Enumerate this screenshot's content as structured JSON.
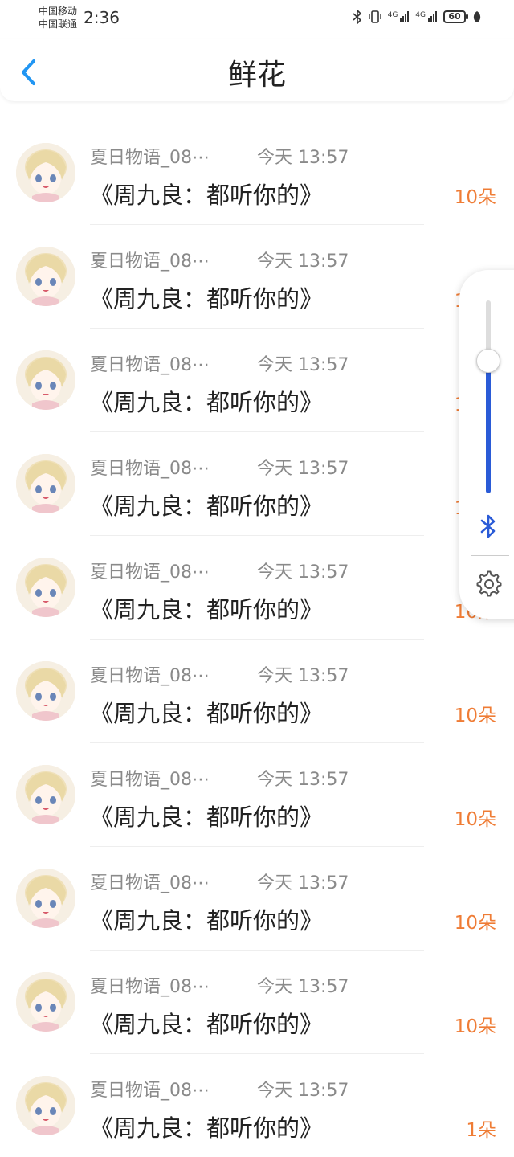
{
  "status_bar": {
    "carrier_1": "中国移动",
    "carrier_2": "中国联通",
    "time": "2:36",
    "net_1": "4G",
    "net_2": "4G",
    "battery": "60"
  },
  "header": {
    "title": "鲜花",
    "back_icon": "chevron-left-icon"
  },
  "items": [
    {
      "name": "夏日物语_08⋯",
      "time": "今天 13:57",
      "desc": "《周九良：都听你的》",
      "count": "10朵"
    },
    {
      "name": "夏日物语_08⋯",
      "time": "今天 13:57",
      "desc": "《周九良：都听你的》",
      "count": "10朵"
    },
    {
      "name": "夏日物语_08⋯",
      "time": "今天 13:57",
      "desc": "《周九良：都听你的》",
      "count": "10朵"
    },
    {
      "name": "夏日物语_08⋯",
      "time": "今天 13:57",
      "desc": "《周九良：都听你的》",
      "count": "10朵"
    },
    {
      "name": "夏日物语_08⋯",
      "time": "今天 13:57",
      "desc": "《周九良：都听你的》",
      "count": "10朵"
    },
    {
      "name": "夏日物语_08⋯",
      "time": "今天 13:57",
      "desc": "《周九良：都听你的》",
      "count": "10朵"
    },
    {
      "name": "夏日物语_08⋯",
      "time": "今天 13:57",
      "desc": "《周九良：都听你的》",
      "count": "10朵"
    },
    {
      "name": "夏日物语_08⋯",
      "time": "今天 13:57",
      "desc": "《周九良：都听你的》",
      "count": "10朵"
    },
    {
      "name": "夏日物语_08⋯",
      "time": "今天 13:57",
      "desc": "《周九良：都听你的》",
      "count": "10朵"
    },
    {
      "name": "夏日物语_08⋯",
      "time": "今天 13:57",
      "desc": "《周九良：都听你的》",
      "count": "1朵"
    }
  ],
  "volume_panel": {
    "level": 0.69,
    "bluetooth_icon": "bluetooth-icon",
    "settings_icon": "gear-icon"
  },
  "colors": {
    "accent": "#2196f3",
    "count": "#ef7c35",
    "slider": "#2a5bd7"
  }
}
